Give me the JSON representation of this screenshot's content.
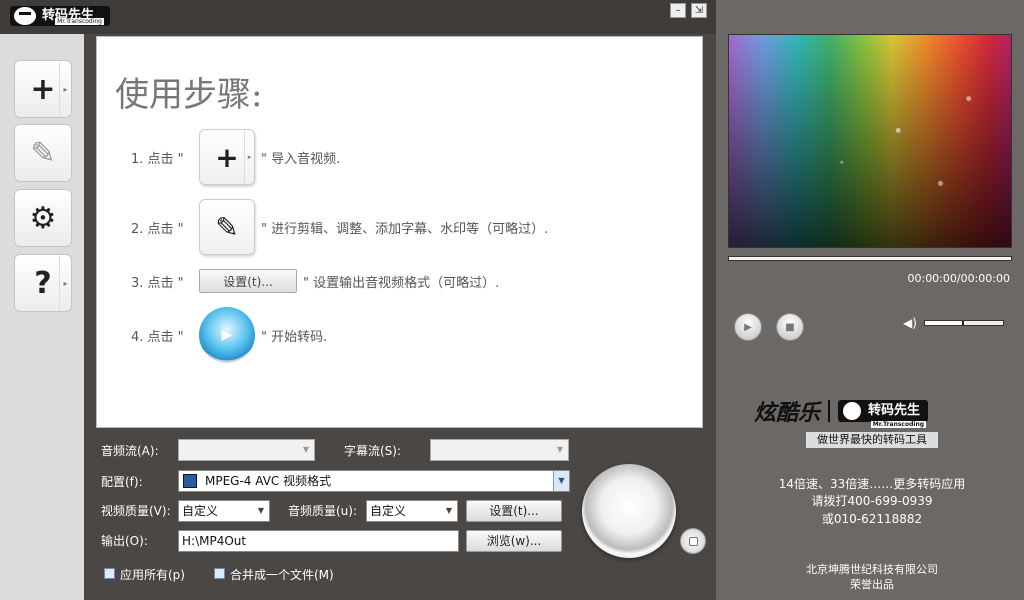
{
  "app": {
    "logo_text": "转码先生",
    "logo_sub": "Mr.Transcoding",
    "minimize_label": "–",
    "restore_label": "⇲"
  },
  "left_toolbar": {
    "add_icon": "+",
    "edit_icon": "✎",
    "settings_icon": "⚙",
    "help_icon": "?",
    "arrow": "▸"
  },
  "steps": {
    "title": "使用步骤:",
    "step1": {
      "num": "1. 点击 \"",
      "suffix": "\" 导入音视频."
    },
    "step2": {
      "num": "2. 点击 \"",
      "suffix": "\" 进行剪辑、调整、添加字幕、水印等（可略过）."
    },
    "step3": {
      "num": "3. 点击 \"",
      "button": "设置(t)...",
      "suffix": "\" 设置输出音视频格式（可略过）."
    },
    "step4": {
      "num": "4. 点击 \"",
      "suffix": "\" 开始转码."
    }
  },
  "controls": {
    "audio_stream_label": "音频流(A):",
    "subtitle_stream_label": "字幕流(S):",
    "config_label": "配置(f):",
    "config_value": "MPEG-4 AVC 视频格式",
    "video_quality_label": "视频质量(V):",
    "video_quality_value": "自定义",
    "audio_quality_label": "音频质量(u):",
    "audio_quality_value": "自定义",
    "settings_button": "设置(t)...",
    "output_label": "输出(O):",
    "output_value": "H:\\MP4Out",
    "browse_button": "浏览(w)...",
    "apply_all": "应用所有(p)",
    "merge_one": "合并成一个文件(M)"
  },
  "player": {
    "time": "00:00:00/00:00:00",
    "play_icon": "▶",
    "stop_icon": "■",
    "volume_icon": "◀)",
    "volume_level": 0.5
  },
  "promo": {
    "brand_main": "炫酷乐",
    "brand_logo": "转码先生",
    "brand_sub": "Mr.Transcoding",
    "slogan": "做世界最快的转码工具",
    "line1": "14倍速、33倍速……更多转码应用",
    "line2": "请拨打400-699-0939",
    "line3": "或010-62118882",
    "company": "北京坤腾世纪科技有限公司",
    "product": "荣誉出品"
  },
  "colors": {
    "frame": "#4a4744",
    "right_panel": "#6b6865",
    "accent_blue": "#2a93cc"
  }
}
